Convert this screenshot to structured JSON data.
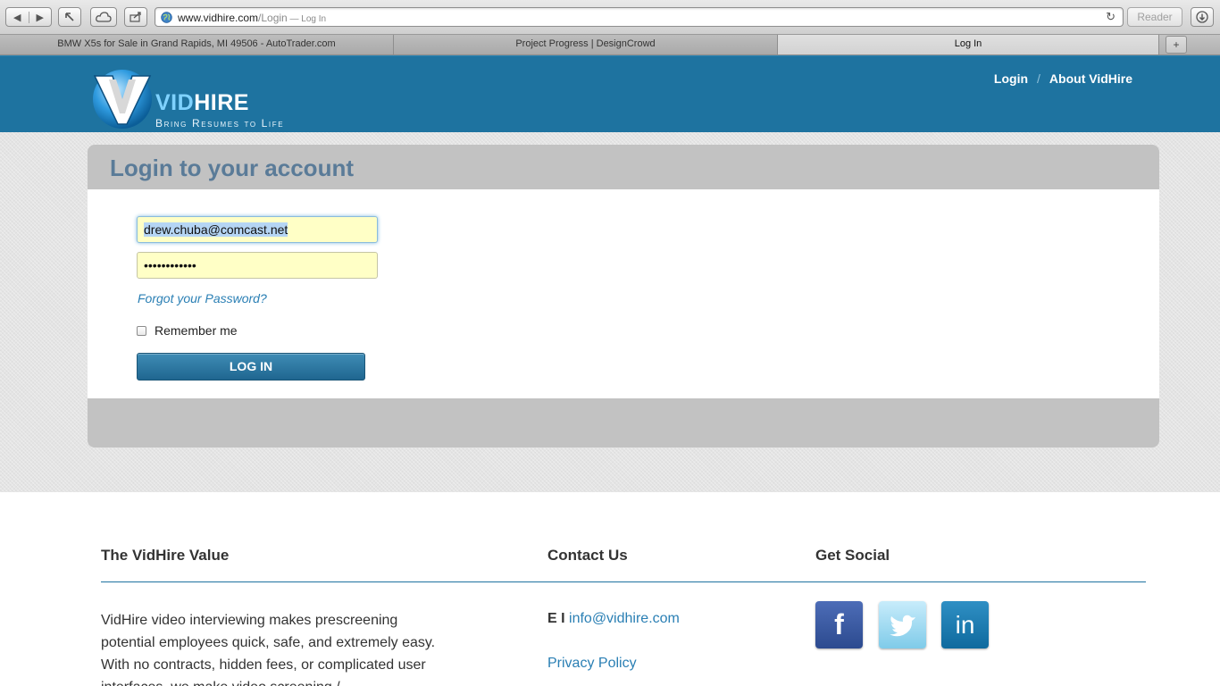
{
  "browser": {
    "back_label": "◀",
    "forward_label": "▶",
    "url_domain": "www.vidhire.com",
    "url_path": "/Login",
    "url_title": " — Log In",
    "reader_label": "Reader",
    "tabs": [
      {
        "label": "BMW X5s for Sale in Grand Rapids, MI 49506 - AutoTrader.com"
      },
      {
        "label": "Project Progress | DesignCrowd"
      },
      {
        "label": "Log In"
      }
    ],
    "new_tab_label": "+"
  },
  "header": {
    "logo_vid": "VID",
    "logo_hire": "HIRE",
    "tagline": "Bring Resumes to Life",
    "nav": [
      {
        "label": "Login"
      },
      {
        "label": "About VidHire"
      }
    ],
    "nav_separator": "/"
  },
  "login": {
    "title": "Login to your account",
    "email_value": "drew.chuba@comcast.net",
    "password_value": "••••••••••••",
    "forgot_label": "Forgot your Password?",
    "remember_label": "Remember me",
    "remember_checked": false,
    "button_label": "LOG IN"
  },
  "footer": {
    "value_heading": "The VidHire Value",
    "value_text": "VidHire video interviewing makes prescreening potential employees quick, safe, and extremely easy. With no contracts, hidden fees, or complicated user interfaces, we make video screening /",
    "contact_heading": "Contact Us",
    "email_prefix": "E I ",
    "email_link": "info@vidhire.com",
    "privacy_label": "Privacy Policy",
    "social_heading": "Get Social",
    "social": [
      {
        "name": "facebook",
        "glyph": "f"
      },
      {
        "name": "twitter",
        "glyph": "🐦"
      },
      {
        "name": "linkedin",
        "glyph": "in"
      }
    ]
  },
  "colors": {
    "header_bg": "#1e73a0",
    "title_color": "#5a7b98",
    "link_color": "#2a7fb4",
    "autofill_bg": "#ffffc6"
  }
}
